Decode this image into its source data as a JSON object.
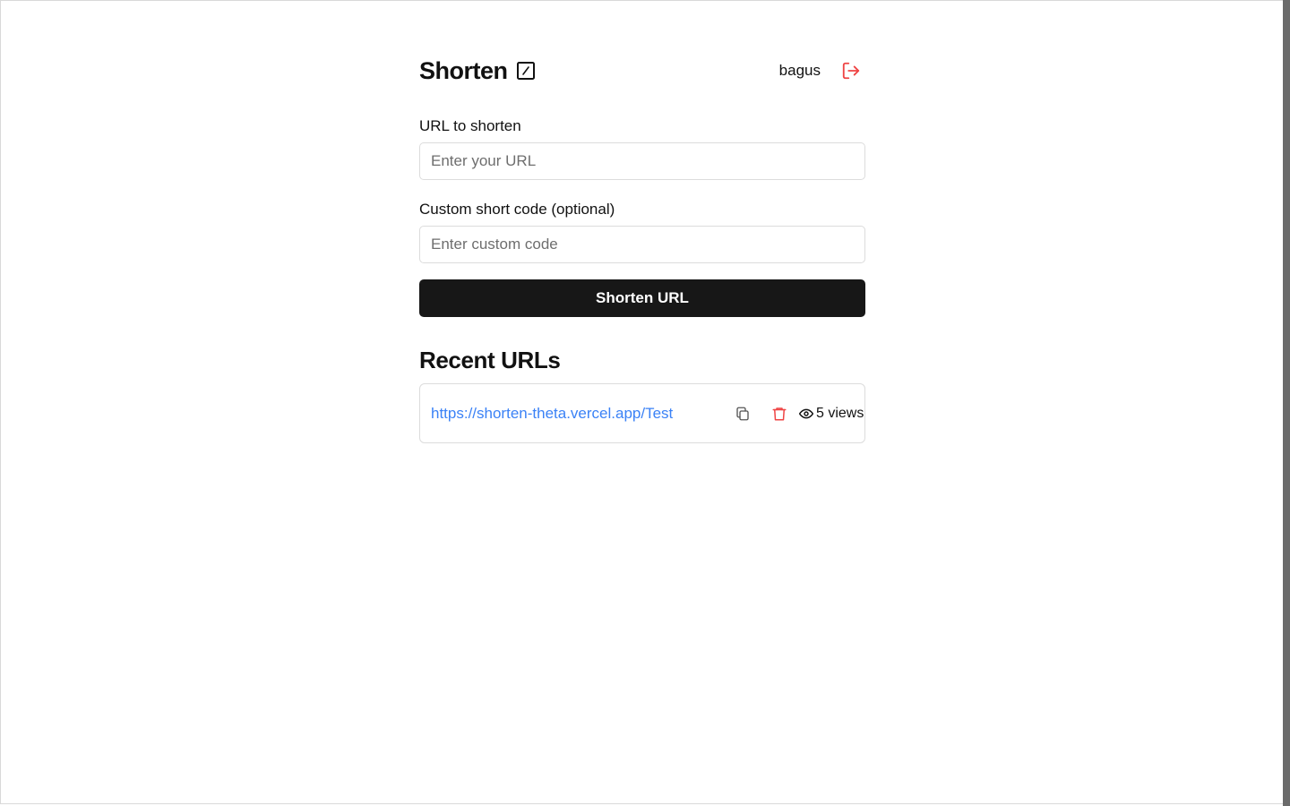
{
  "app": {
    "title": "Shorten",
    "username": "bagus",
    "icons": {
      "brand": "edit-square-icon",
      "logout": "logout-icon"
    },
    "accent": "#ef4444"
  },
  "form": {
    "url_label": "URL to shorten",
    "url_placeholder": "Enter your URL",
    "url_value": "",
    "code_label": "Custom short code (optional)",
    "code_placeholder": "Enter custom code",
    "code_value": "",
    "submit_label": "Shorten URL",
    "submit_bg": "#171717"
  },
  "recent": {
    "title": "Recent URLs",
    "items": [
      {
        "url": "https://shorten-theta.vercel.app/Test",
        "views_label": "5 views",
        "link_color": "#3b82f6",
        "icons": [
          "copy-icon",
          "trash-icon",
          "eye-icon"
        ]
      }
    ]
  }
}
